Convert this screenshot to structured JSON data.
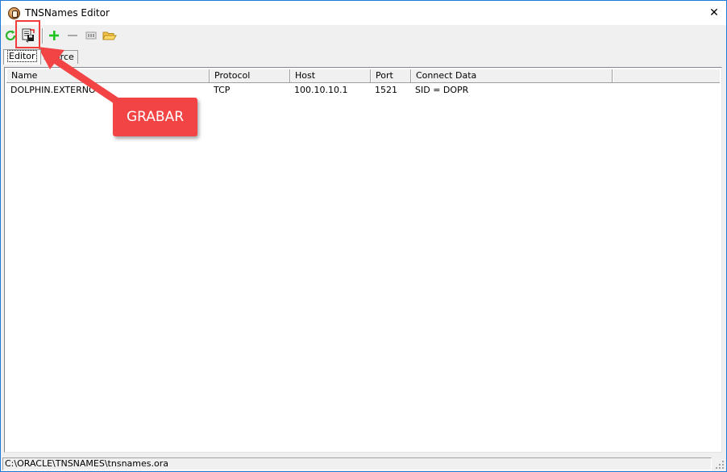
{
  "window": {
    "title": "TNSNames Editor",
    "close_glyph": "✕"
  },
  "toolbar": {
    "buttons": [
      {
        "name": "refresh-icon"
      },
      {
        "name": "save-icon"
      },
      {
        "name": "add-icon"
      },
      {
        "name": "remove-icon"
      },
      {
        "name": "test-connection-icon"
      },
      {
        "name": "open-folder-icon"
      }
    ]
  },
  "tabs": [
    {
      "label": "Editor",
      "active": true
    },
    {
      "label": "Source",
      "active": false
    }
  ],
  "list": {
    "columns": [
      "Name",
      "Protocol",
      "Host",
      "Port",
      "Connect Data"
    ],
    "rows": [
      {
        "name": "DOLPHIN.EXTERNO",
        "protocol": "TCP",
        "host": "100.10.10.1",
        "port": "1521",
        "connect_data": "SID = DOPR"
      }
    ]
  },
  "statusbar": {
    "path": "C:\\ORACLE\\TNSNAMES\\tnsnames.ora"
  },
  "annotation": {
    "label": "GRABAR",
    "color": "#f24444"
  },
  "colors": {
    "accent_border": "#1c7bd6",
    "refresh_green": "#2db52d",
    "add_green": "#1fc41f"
  }
}
